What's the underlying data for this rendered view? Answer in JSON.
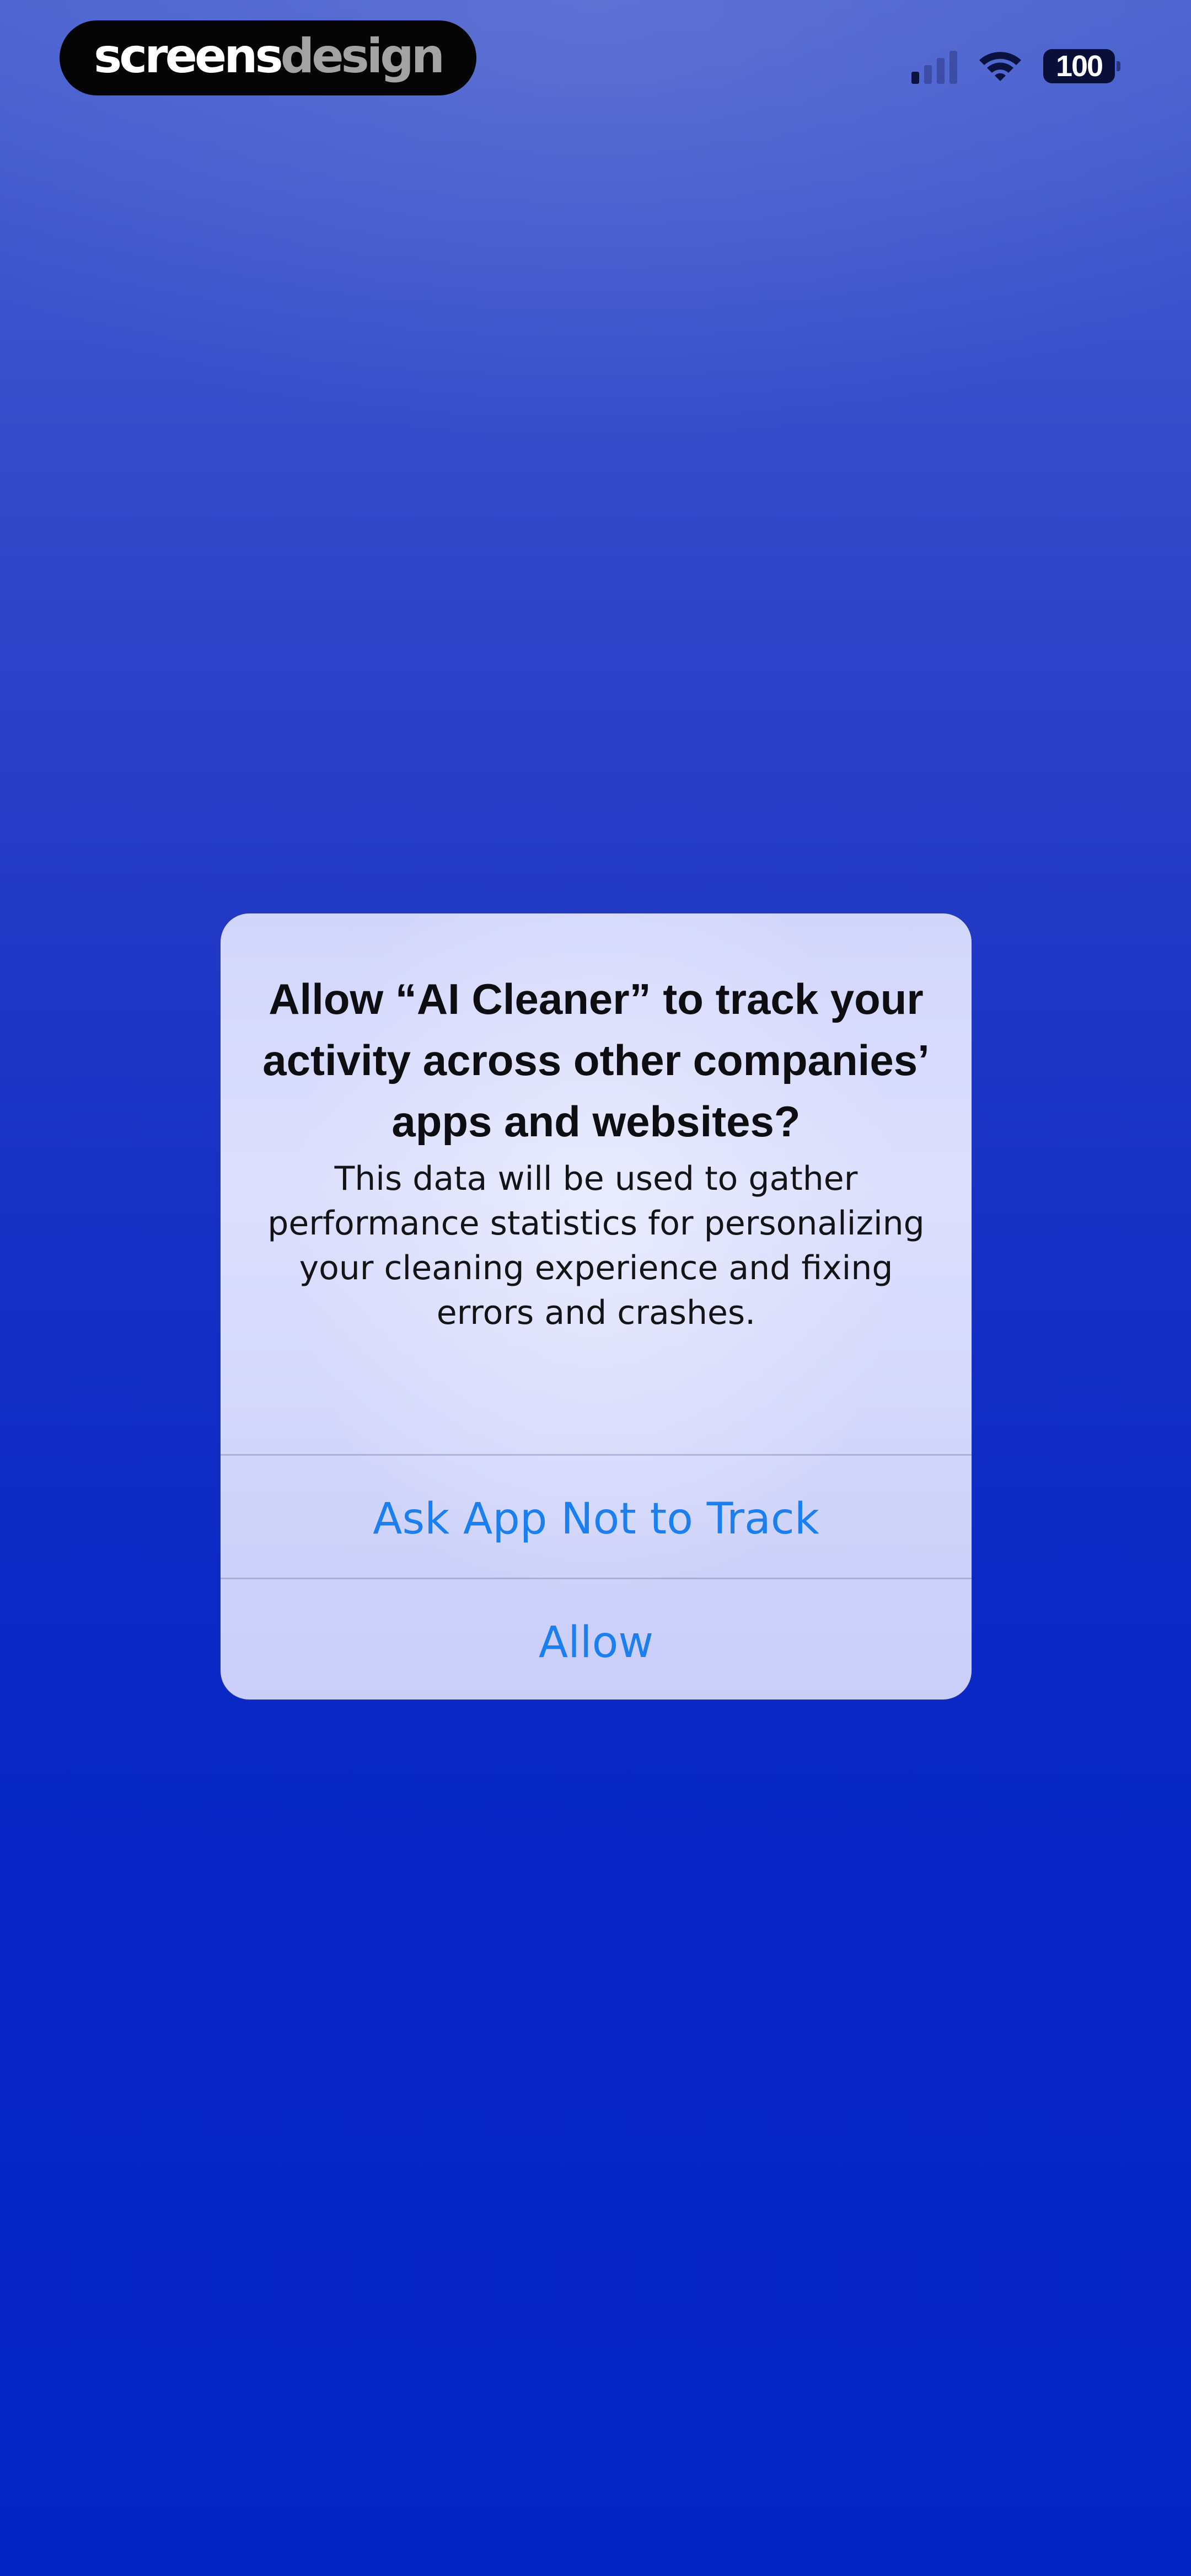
{
  "watermark": {
    "part_a": "screens",
    "part_b": "design"
  },
  "status_bar": {
    "signal_bars_active": 1,
    "signal_bars_total": 4,
    "battery_level": "100"
  },
  "alert": {
    "title": "Allow “AI Cleaner” to track your activity across other companies’ apps and websites?",
    "message": "This data will be used to gather performance statistics for personalizing your cleaning experience and fixing errors and crashes.",
    "actions": [
      {
        "label": "Ask App Not to Track"
      },
      {
        "label": "Allow"
      }
    ]
  },
  "colors": {
    "action_text": "#1c7ff0",
    "background_top": "#4a62cf",
    "background_bottom": "#0423c4",
    "alert_background": "#d2d6fb"
  }
}
